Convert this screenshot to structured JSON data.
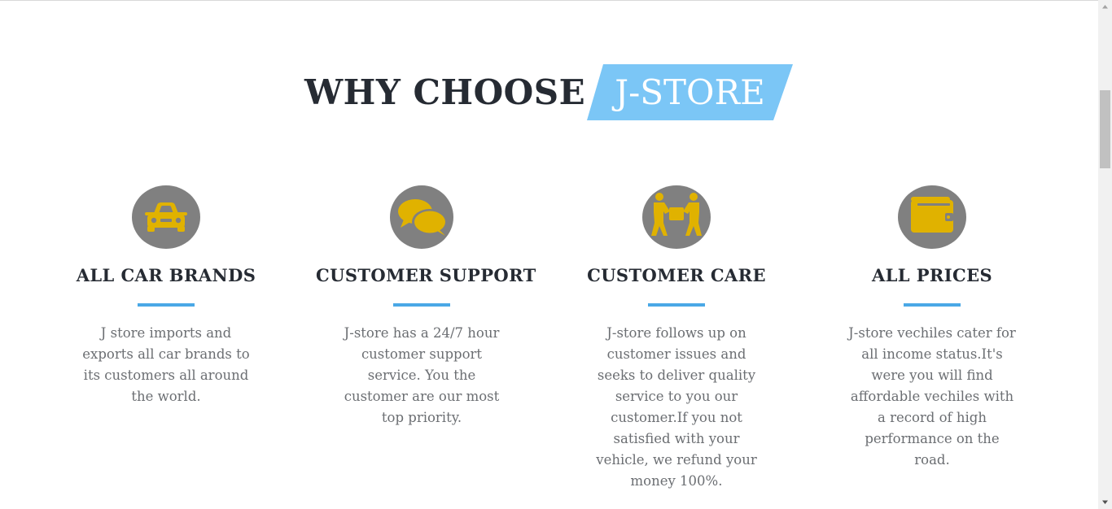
{
  "heading": {
    "dark": "WHY CHOOSE",
    "badge": "J-STORE"
  },
  "colors": {
    "accent": "#4aa8e6",
    "badge": "#7bc6f6",
    "icon_bg": "#808080",
    "icon_fg": "#e0b200",
    "heading": "#262b33",
    "body_text": "#6b6e72"
  },
  "features": [
    {
      "icon": "car-icon",
      "title": "ALL CAR BRANDS",
      "description": "J store imports and exports all car brands to its customers all around the world."
    },
    {
      "icon": "chat-bubbles-icon",
      "title": "CUSTOMER SUPPORT",
      "description": "J-store has a 24/7 hour customer support service. You the customer are our most top priority."
    },
    {
      "icon": "people-carrying-box-icon",
      "title": "CUSTOMER CARE",
      "description": "J-store follows up on customer issues and seeks to deliver quality service to you our customer.If you not satisfied with your vehicle, we refund your money 100%."
    },
    {
      "icon": "wallet-icon",
      "title": "ALL PRICES",
      "description": "J-store vechiles cater for all income status.It's were you will find affordable vechiles with a record of high performance on the road."
    }
  ]
}
